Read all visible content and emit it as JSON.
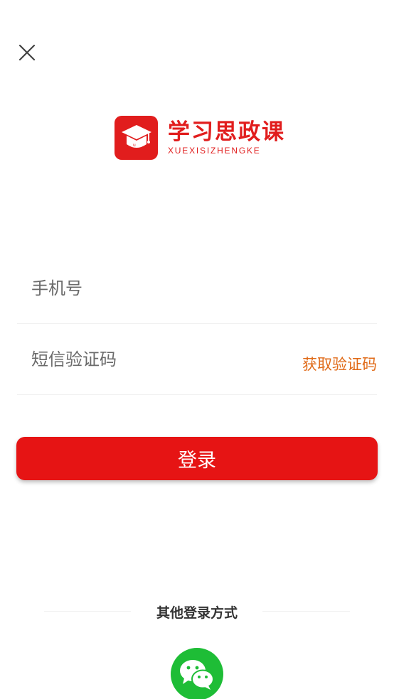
{
  "logo": {
    "title_cn": "学习思政课",
    "title_en": "XUEXISIZHENGKE"
  },
  "form": {
    "phone_placeholder": "手机号",
    "code_placeholder": "短信验证码",
    "get_code_label": "获取验证码",
    "login_label": "登录"
  },
  "other_login": {
    "title": "其他登录方式"
  },
  "colors": {
    "brand_red": "#e11d1d",
    "accent_orange": "#e06a17",
    "wechat_green": "#1ebd36"
  }
}
